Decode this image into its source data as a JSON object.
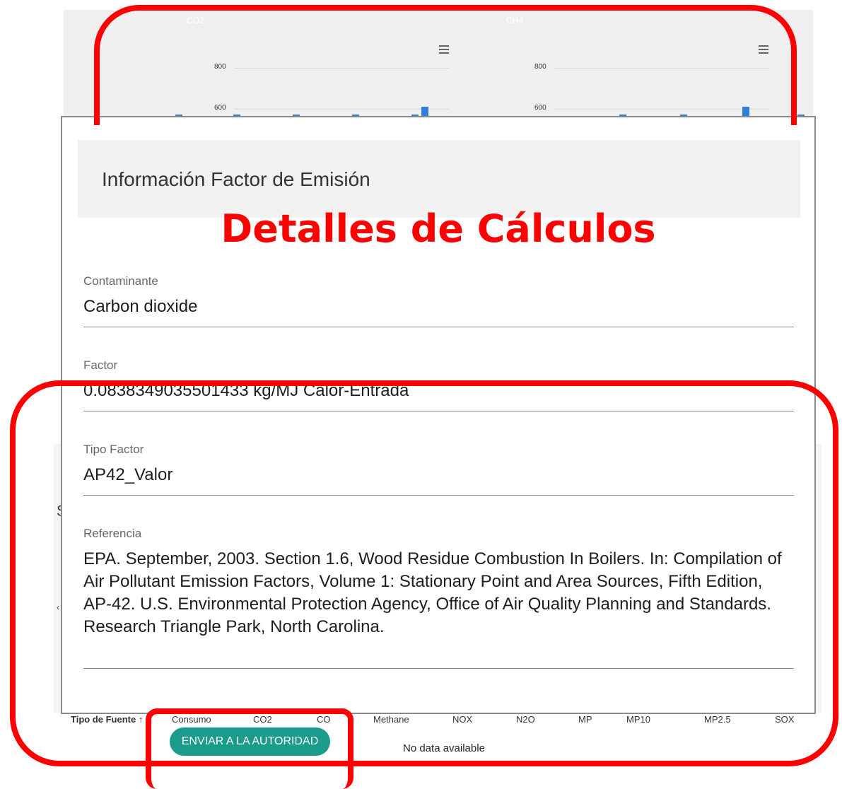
{
  "charts": [
    {
      "title": "CO2",
      "ticks": [
        "800",
        "600"
      ]
    },
    {
      "title": "CH4",
      "ticks": [
        "800",
        "600"
      ]
    }
  ],
  "modal": {
    "title": "Información Factor de Emisión",
    "annotation": "Detalles de Cálculos",
    "fields": [
      {
        "label": "Contaminante",
        "value": "Carbon dioxide"
      },
      {
        "label": "Factor",
        "value": "0.0838349035501433 kg/MJ Calor-Entrada"
      },
      {
        "label": "Tipo Factor",
        "value": "AP42_Valor"
      },
      {
        "label": "Referencia",
        "value": "EPA.  September, 2003.  Section 1.6, Wood Residue Combustion In Boilers.  In: Compilation of Air Pollutant Emission Factors, Volume 1: Stationary Point and Area Sources, Fifth Edition, AP-42.  U.S. Environmental Protection Agency, Office of Air Quality Planning and Standards.  Research Triangle Park, North Carolina."
      }
    ]
  },
  "table": {
    "columns": [
      "Tipo de Fuente ↑",
      "Consumo",
      "CO2",
      "CO",
      "Methane",
      "NOX",
      "N2O",
      "MP",
      "MP10",
      "MP2.5",
      "SOX"
    ],
    "empty_text": "No data available"
  },
  "send_button": "ENVIAR A LA AUTORIDAD",
  "colors": {
    "annotation": "#ff0000",
    "button": "#1a9b8c",
    "bars": "#2f7ed8"
  },
  "icons": [
    "menu-icon"
  ]
}
